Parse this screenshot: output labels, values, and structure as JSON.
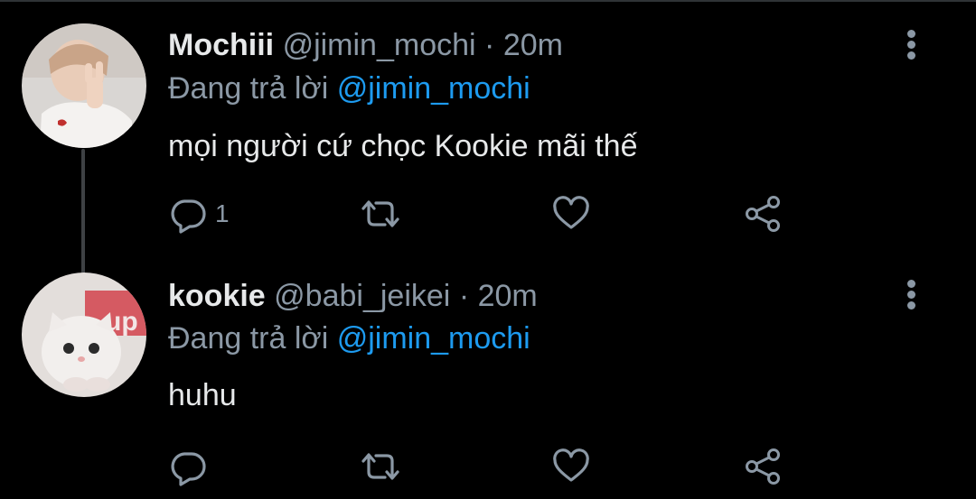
{
  "tweets": [
    {
      "name": "Mochiii",
      "handle": "@jimin_mochi",
      "separator": "·",
      "time": "20m",
      "reply_prefix": "Đang trả lời",
      "reply_mention": "@jimin_mochi",
      "text": "mọi người cứ chọc Kookie mãi thế",
      "reply_count": "1",
      "avatar_icon": "avatar-photo"
    },
    {
      "name": "kookie",
      "handle": "@babi_jeikei",
      "separator": "·",
      "time": "20m",
      "reply_prefix": "Đang trả lời",
      "reply_mention": "@jimin_mochi",
      "text": "huhu",
      "reply_count": "",
      "avatar_icon": "kitten-avatar-photo"
    }
  ],
  "icons": {
    "reply": "reply-bubble-icon",
    "retweet": "retweet-icon",
    "like": "heart-icon",
    "share": "share-icon",
    "more": "more-vertical-icon"
  },
  "colors": {
    "background": "#000000",
    "primary_text": "#e7e9ea",
    "secondary_text": "#8b98a5",
    "mention": "#1d9bf0",
    "thread_line": "#3e4144"
  }
}
